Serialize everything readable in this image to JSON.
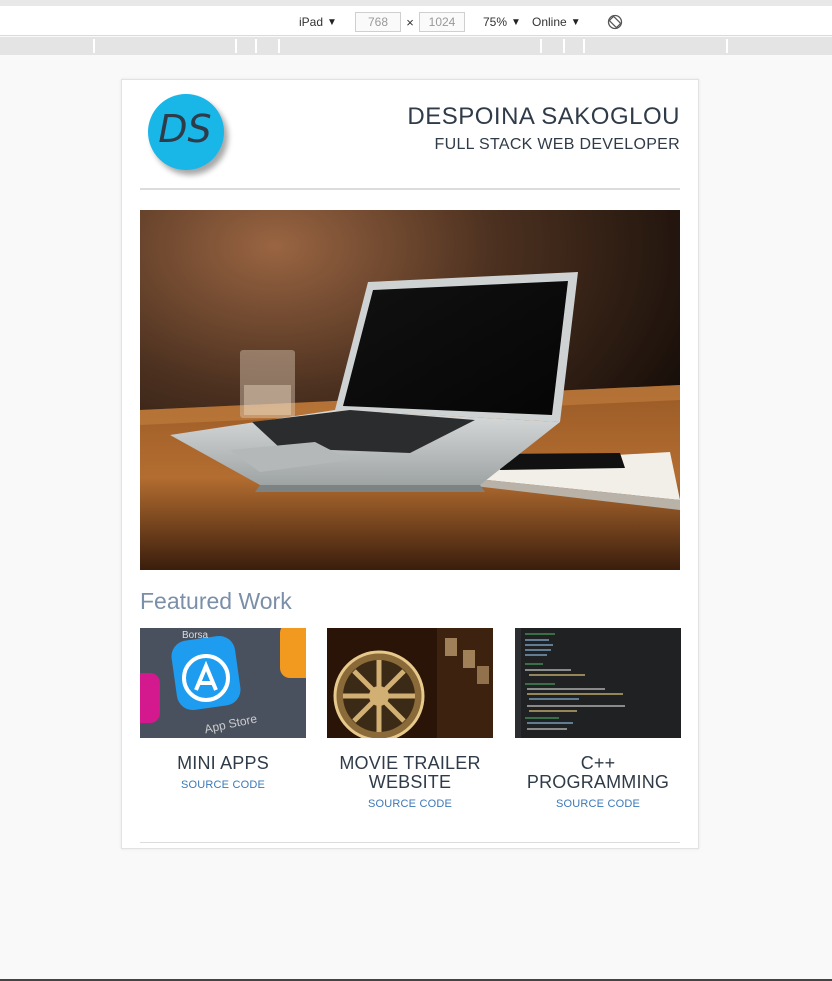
{
  "devtools": {
    "device": "iPad",
    "width": "768",
    "height": "1024",
    "zoom": "75%",
    "network": "Online",
    "icons": [
      "chevron-down-icon",
      "rotate-icon"
    ]
  },
  "header": {
    "logo_text": "DS",
    "name": "DESPOINA SAKOGLOU",
    "role": "FULL STACK WEB DEVELOPER",
    "logo_color": "#19b6e8"
  },
  "featured": {
    "title": "Featured Work",
    "projects": [
      {
        "title": "MINI APPS",
        "link": "SOURCE CODE"
      },
      {
        "title": "MOVIE TRAILER WEBSITE",
        "link": "SOURCE CODE"
      },
      {
        "title": "C++ PROGRAMMING",
        "link": "SOURCE CODE"
      }
    ]
  },
  "colors": {
    "text_dark": "#2f3b48",
    "section_title": "#7b8fa8",
    "link": "#3a78b8"
  }
}
